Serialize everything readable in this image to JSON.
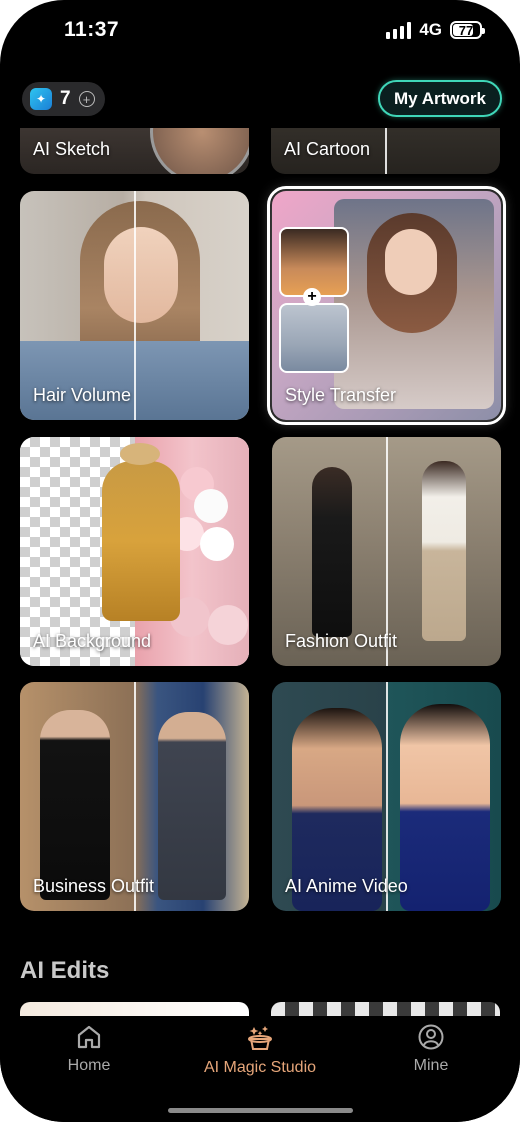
{
  "status_bar": {
    "time": "11:37",
    "network": "4G",
    "battery": "77",
    "battery_level": 0.77
  },
  "header": {
    "credits_count": "7",
    "my_artwork_label": "My Artwork"
  },
  "tiles": [
    {
      "label": "AI Sketch"
    },
    {
      "label": "AI Cartoon"
    },
    {
      "label": "Hair Volume"
    },
    {
      "label": "Style Transfer",
      "selected": true
    },
    {
      "label": "AI Background"
    },
    {
      "label": "Fashion Outfit"
    },
    {
      "label": "Business Outfit"
    },
    {
      "label": "AI Anime Video"
    }
  ],
  "section_title": "AI Edits",
  "nav": {
    "items": [
      {
        "label": "Home",
        "icon": "home-icon"
      },
      {
        "label": "AI Magic Studio",
        "icon": "magic-hat-icon",
        "active": true
      },
      {
        "label": "Mine",
        "icon": "user-icon"
      }
    ]
  },
  "colors": {
    "accent": "#e6a67a",
    "artwork_border": "#3fd6b8",
    "background": "#000000"
  }
}
